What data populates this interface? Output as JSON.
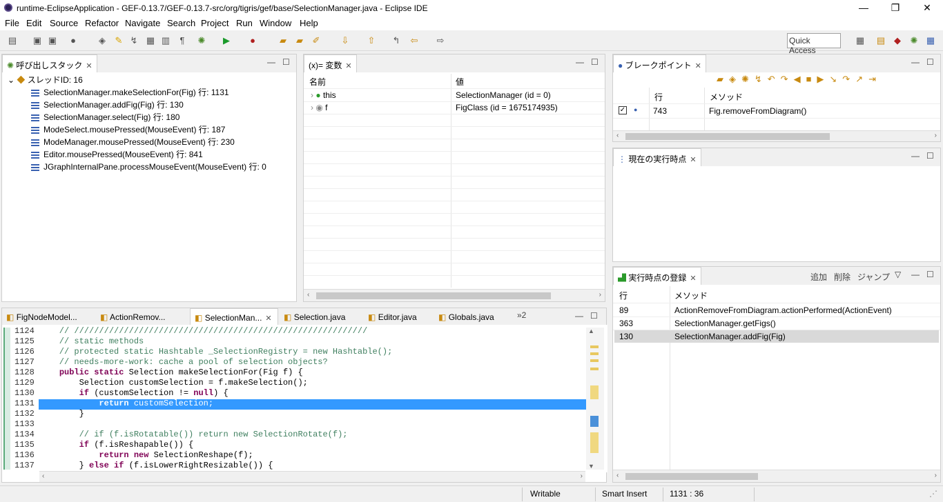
{
  "window": {
    "title": "runtime-EclipseApplication - GEF-0.13.7/GEF-0.13.7-src/org/tigris/gef/base/SelectionManager.java - Eclipse IDE",
    "minimize": "—",
    "restore": "❐",
    "close": "✕"
  },
  "menu": [
    "File",
    "Edit",
    "Source",
    "Refactor",
    "Navigate",
    "Search",
    "Project",
    "Run",
    "Window",
    "Help"
  ],
  "toolbar": {
    "quick_access": "Quick Access"
  },
  "callstack": {
    "tab": "呼び出しスタック",
    "thread": "スレッドID: 16",
    "frames": [
      "SelectionManager.makeSelectionFor(Fig) 行: 1131",
      "SelectionManager.addFig(Fig) 行: 130",
      "SelectionManager.select(Fig) 行: 180",
      "ModeSelect.mousePressed(MouseEvent) 行: 187",
      "ModeManager.mousePressed(MouseEvent) 行: 230",
      "Editor.mousePressed(MouseEvent) 行: 841",
      "JGraphInternalPane.processMouseEvent(MouseEvent) 行: 0"
    ]
  },
  "variables": {
    "tab": "(x)= 変数",
    "col_name": "名前",
    "col_value": "値",
    "rows": [
      {
        "name": "this",
        "value": "SelectionManager (id = 0)"
      },
      {
        "name": "f",
        "value": "FigClass (id = 1675174935)"
      }
    ]
  },
  "breakpoints": {
    "tab": "ブレークポイント",
    "col_line": "行",
    "col_method": "メソッド",
    "rows": [
      {
        "line": "743",
        "method": "Fig.removeFromDiagram()",
        "checked": true
      }
    ]
  },
  "current": {
    "tab": "現在の実行時点"
  },
  "registry": {
    "tab": "実行時点の登録",
    "add": "追加",
    "remove": "削除",
    "jump": "ジャンプ",
    "col_line": "行",
    "col_method": "メソッド",
    "rows": [
      {
        "line": "89",
        "method": "ActionRemoveFromDiagram.actionPerformed(ActionEvent)"
      },
      {
        "line": "363",
        "method": "SelectionManager.getFigs()"
      },
      {
        "line": "130",
        "method": "SelectionManager.addFig(Fig)"
      }
    ]
  },
  "editor": {
    "tabs": [
      "FigNodeModel...",
      "ActionRemov...",
      "SelectionMan...",
      "Selection.java",
      "Editor.java",
      "Globals.java"
    ],
    "overflow": "»2",
    "lines": [
      {
        "n": "1124",
        "t": "    // ///////////////////////////////////////////////////////////"
      },
      {
        "n": "1125",
        "t": "    // static methods"
      },
      {
        "n": "1126",
        "t": "    // protected static Hashtable _SelectionRegistry = new Hashtable();"
      },
      {
        "n": "1127",
        "t": "    // needs-more-work: cache a pool of selection objects?"
      },
      {
        "n": "1128",
        "t": "    public static Selection makeSelectionFor(Fig f) {"
      },
      {
        "n": "1129",
        "t": "        Selection customSelection = f.makeSelection();"
      },
      {
        "n": "1130",
        "t": "        if (customSelection != null) {"
      },
      {
        "n": "1131",
        "t": "            return customSelection;"
      },
      {
        "n": "1132",
        "t": "        }"
      },
      {
        "n": "1133",
        "t": ""
      },
      {
        "n": "1134",
        "t": "        // if (f.isRotatable()) return new SelectionRotate(f);"
      },
      {
        "n": "1135",
        "t": "        if (f.isReshapable()) {"
      },
      {
        "n": "1136",
        "t": "            return new SelectionReshape(f);"
      },
      {
        "n": "1137",
        "t": "        } else if (f.isLowerRightResizable()) {"
      }
    ]
  },
  "status": {
    "writable": "Writable",
    "insert": "Smart Insert",
    "pos": "1131 : 36"
  }
}
